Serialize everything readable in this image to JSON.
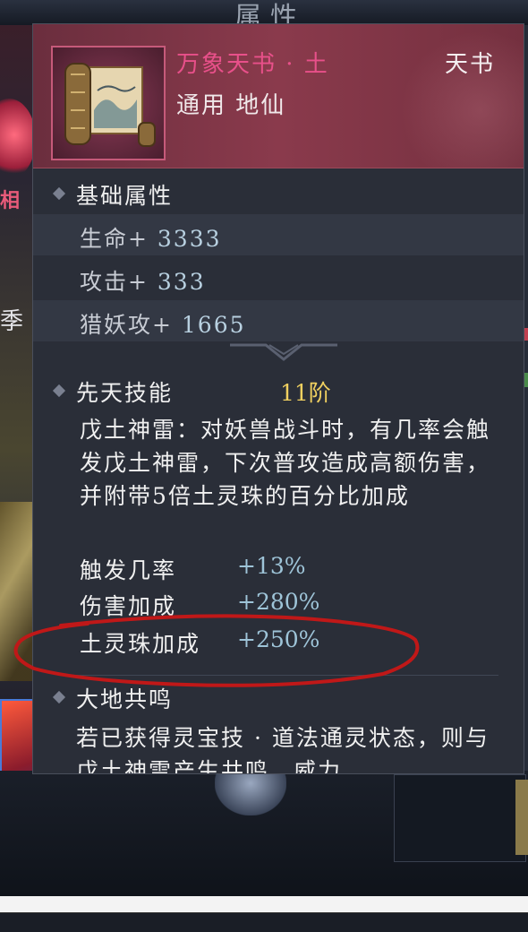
{
  "background": {
    "top_title": "属性",
    "left_labels": [
      "相",
      "季"
    ]
  },
  "item": {
    "name": "万象天书 · 土",
    "category": "天书",
    "subtitle": "通用 地仙",
    "icon": "scroll-icon"
  },
  "base_attributes": {
    "title": "基础属性",
    "rows": [
      {
        "label": "生命+",
        "value": "3333"
      },
      {
        "label": "攻击+",
        "value": "333"
      },
      {
        "label": "猎妖攻+",
        "value": "1665"
      }
    ]
  },
  "innate_skill": {
    "title": "先天技能",
    "level": "11阶",
    "description": "戊土神雷：对妖兽战斗时，有几率会触发戊土神雷，下次普攻造成高额伤害，并附带5倍土灵珠的百分比加成",
    "stats": [
      {
        "label": "触发几率",
        "value": "+13%"
      },
      {
        "label": "伤害加成",
        "value": "+280%"
      },
      {
        "label": "土灵珠加成",
        "value": "+250%"
      }
    ]
  },
  "resonance": {
    "title": "大地共鸣",
    "description": "若已获得灵宝技 · 道法通灵状态，则与戊土神雷产生共鸣，威力"
  },
  "colors": {
    "item_name": "#e8508a",
    "level": "#f0d060",
    "stat_value": "#9ec4d8",
    "annotation": "#c01818"
  }
}
